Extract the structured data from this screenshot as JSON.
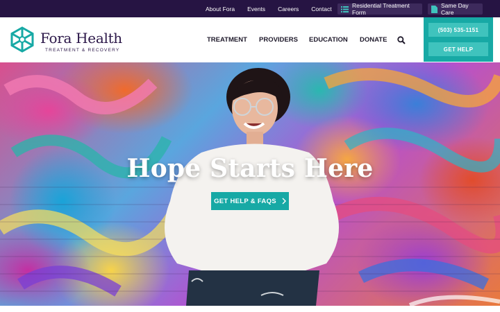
{
  "topbar": {
    "links": [
      "About Fora",
      "Events",
      "Careers",
      "Contact"
    ],
    "residential_label": "Residential Treatment Form",
    "same_day_label": "Same Day Care"
  },
  "logo": {
    "name": "Fora Health",
    "tagline": "TREATMENT & RECOVERY"
  },
  "nav": {
    "items": [
      "TREATMENT",
      "PROVIDERS",
      "EDUCATION",
      "DONATE"
    ]
  },
  "cta": {
    "phone": "(503) 535-1151",
    "get_help": "GET HELP"
  },
  "hero": {
    "title": "Hope Starts Here",
    "button_label": "GET HELP & FAQS"
  },
  "colors": {
    "topbar": "#261443",
    "brand_purple": "#2b1748",
    "teal": "#17a9a5",
    "teal_light": "#3fc3bd"
  }
}
